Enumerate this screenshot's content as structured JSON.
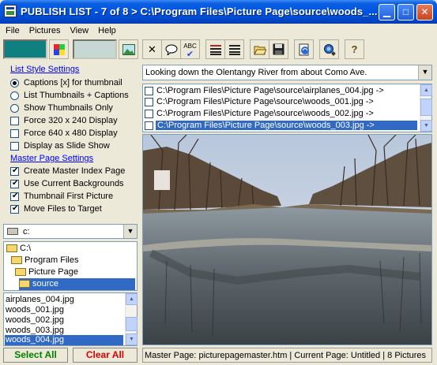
{
  "window": {
    "title": "PUBLISH LIST - 7 of 8 > C:\\Program Files\\Picture Page\\source\\woods_..."
  },
  "menu": [
    "File",
    "Pictures",
    "View",
    "Help"
  ],
  "toolbar": {
    "colors": {
      "swatch1": "#0f7f7f",
      "swatch2": "#c6d7d4"
    },
    "icons": [
      "palette-icon",
      "image-icon",
      "delete-icon",
      "comment-icon",
      "spellcheck-icon",
      "list-icon",
      "list-alt-icon",
      "open-folder-icon",
      "save-icon",
      "web-icon",
      "preview-icon",
      "help-icon"
    ]
  },
  "list_style": {
    "heading": "List Style Settings",
    "radios": [
      {
        "label": "Captions [x] for thumbnail",
        "checked": true
      },
      {
        "label": "List Thumbnails + Captions",
        "checked": false
      },
      {
        "label": "Show Thumbnails Only",
        "checked": false
      }
    ],
    "checks": [
      {
        "label": "Force 320 x 240 Display",
        "checked": false
      },
      {
        "label": "Force 640 x 480 Display",
        "checked": false
      },
      {
        "label": "Display as Slide Show",
        "checked": false
      }
    ]
  },
  "master_page": {
    "heading": "Master Page Settings",
    "checks": [
      {
        "label": "Create Master Index Page",
        "checked": true
      },
      {
        "label": "Use Current Backgrounds",
        "checked": true
      },
      {
        "label": "Thumbnail First Picture",
        "checked": true
      },
      {
        "label": "Move Files to Target",
        "checked": true
      }
    ]
  },
  "drive": {
    "value": "c:"
  },
  "folders": [
    "C:\\",
    "Program Files",
    "Picture Page",
    "source"
  ],
  "files": [
    "airplanes_004.jpg",
    "woods_001.jpg",
    "woods_002.jpg",
    "woods_003.jpg",
    "woods_004.jpg"
  ],
  "buttons": {
    "select_all": "Select All",
    "clear_all": "Clear All"
  },
  "description": {
    "value": "Looking down the Olentangy River from about Como Ave."
  },
  "publish_list": [
    "C:\\Program Files\\Picture Page\\source\\airplanes_004.jpg ->",
    "C:\\Program Files\\Picture Page\\source\\woods_001.jpg ->",
    "C:\\Program Files\\Picture Page\\source\\woods_002.jpg ->",
    "C:\\Program Files\\Picture Page\\source\\woods_003.jpg ->"
  ],
  "status": {
    "text": "Master Page: picturepagemaster.htm | Current Page: Untitled | 8 Pictures"
  }
}
